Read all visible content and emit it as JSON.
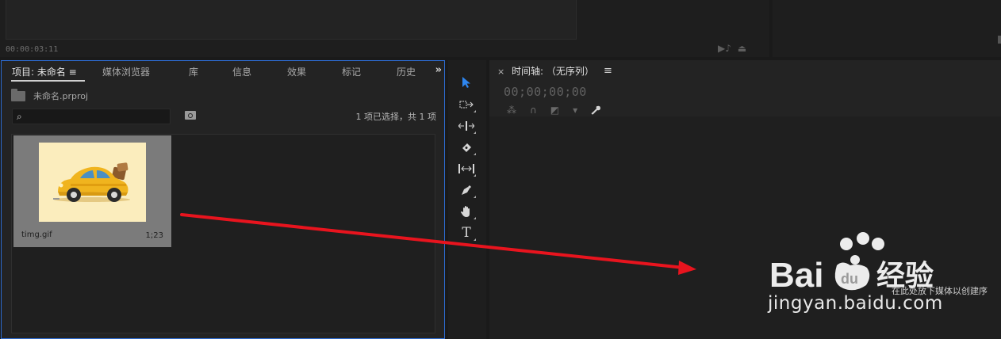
{
  "top_monitor": {
    "timecode": "00:00:03:11"
  },
  "project_panel": {
    "tabs": [
      {
        "label": "项目: 未命名 ≡"
      },
      {
        "label": "媒体浏览器"
      },
      {
        "label": "库"
      },
      {
        "label": "信息"
      },
      {
        "label": "效果"
      },
      {
        "label": "标记"
      },
      {
        "label": "历史"
      }
    ],
    "more": "»",
    "project_file": "未命名.prproj",
    "search_placeholder": "",
    "selection_count": "1 项已选择，共 1 项",
    "clip": {
      "name": "timg.gif",
      "duration": "1;23",
      "thumbnail_bg": "#fbedbd"
    }
  },
  "tools": [
    {
      "name": "selection-tool",
      "icon": "arrow-icon"
    },
    {
      "name": "track-select-tool",
      "icon": "track-select-icon"
    },
    {
      "name": "ripple-edit-tool",
      "icon": "ripple-edit-icon"
    },
    {
      "name": "razor-tool",
      "icon": "razor-icon"
    },
    {
      "name": "slip-tool",
      "icon": "slip-icon"
    },
    {
      "name": "pen-tool",
      "icon": "pen-icon"
    },
    {
      "name": "hand-tool",
      "icon": "hand-icon"
    },
    {
      "name": "type-tool",
      "icon": "type-icon",
      "glyph": "T"
    }
  ],
  "timeline": {
    "close": "×",
    "title": "时间轴: （无序列）",
    "menu": "≡",
    "timecode": "00;00;00;00",
    "drop_hint": "在此处放下媒体以创建序"
  },
  "annotation": {
    "arrow_color": "#e8141e"
  },
  "watermark": {
    "brand": "Bai 经验",
    "url": "jingyan.baidu.com"
  },
  "colors": {
    "accent": "#2e86f0",
    "panel_border": "#2d6bd1"
  }
}
